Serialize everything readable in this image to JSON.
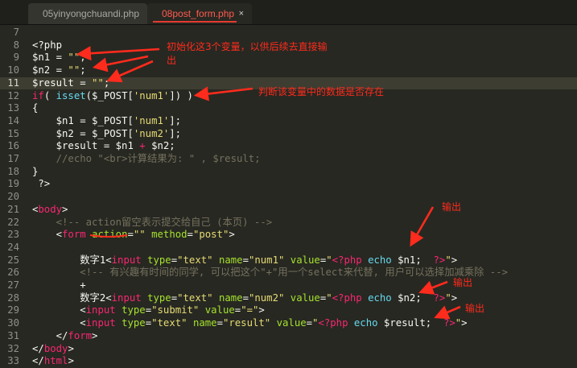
{
  "tabs": [
    {
      "label": "05yinyongchuandi.php",
      "close": "×",
      "active": false
    },
    {
      "label": "08post_form.php",
      "close": "×",
      "active": true
    }
  ],
  "lines": [
    {
      "n": "7",
      "t": [
        [
          "v",
          ""
        ]
      ]
    },
    {
      "n": "8",
      "t": [
        [
          "v",
          "<?php"
        ]
      ]
    },
    {
      "n": "9",
      "t": [
        [
          "v",
          "$n1 = "
        ],
        [
          "s",
          "\"\""
        ],
        [
          "v",
          ";"
        ]
      ]
    },
    {
      "n": "10",
      "t": [
        [
          "v",
          "$n2 = "
        ],
        [
          "s",
          "\"\""
        ],
        [
          "v",
          ";"
        ]
      ]
    },
    {
      "n": "11",
      "t": [
        [
          "v",
          "$result = "
        ],
        [
          "s",
          "\"\""
        ],
        [
          "v",
          ";"
        ]
      ],
      "current": true
    },
    {
      "n": "12",
      "t": [
        [
          "k",
          "if"
        ],
        [
          "v",
          "( "
        ],
        [
          "f",
          "isset"
        ],
        [
          "v",
          "($_POST["
        ],
        [
          "s",
          "'num1'"
        ],
        [
          "v",
          "]) )"
        ]
      ]
    },
    {
      "n": "13",
      "t": [
        [
          "v",
          "{"
        ]
      ]
    },
    {
      "n": "14",
      "t": [
        [
          "v",
          "    $n1 = $_POST["
        ],
        [
          "s",
          "'num1'"
        ],
        [
          "v",
          "];"
        ]
      ]
    },
    {
      "n": "15",
      "t": [
        [
          "v",
          "    $n2 = $_POST["
        ],
        [
          "s",
          "'num2'"
        ],
        [
          "v",
          "];"
        ]
      ]
    },
    {
      "n": "16",
      "t": [
        [
          "v",
          "    $result = $n1 "
        ],
        [
          "k",
          "+"
        ],
        [
          "v",
          " $n2;"
        ]
      ]
    },
    {
      "n": "17",
      "t": [
        [
          "c",
          "    //echo \"<br>计算结果为: \" , $result;"
        ]
      ]
    },
    {
      "n": "18",
      "t": [
        [
          "v",
          "}"
        ]
      ]
    },
    {
      "n": "19",
      "t": [
        [
          "v",
          " ?>"
        ]
      ]
    },
    {
      "n": "20",
      "t": [
        [
          "v",
          ""
        ]
      ]
    },
    {
      "n": "21",
      "t": [
        [
          "v",
          "<"
        ],
        [
          "t",
          "body"
        ],
        [
          "v",
          ">"
        ]
      ]
    },
    {
      "n": "22",
      "t": [
        [
          "c",
          "    <!-- action留空表示提交给自己 (本页) -->"
        ]
      ]
    },
    {
      "n": "23",
      "t": [
        [
          "v",
          "    <"
        ],
        [
          "t",
          "form"
        ],
        [
          "v",
          " "
        ],
        [
          "a",
          "action"
        ],
        [
          "v",
          "="
        ],
        [
          "s",
          "\"\""
        ],
        [
          "v",
          " "
        ],
        [
          "a",
          "method"
        ],
        [
          "v",
          "="
        ],
        [
          "s",
          "\"post\""
        ],
        [
          "v",
          ">"
        ]
      ]
    },
    {
      "n": "24",
      "t": [
        [
          "v",
          ""
        ]
      ]
    },
    {
      "n": "25",
      "t": [
        [
          "v",
          "        数字1<"
        ],
        [
          "t",
          "input"
        ],
        [
          "v",
          " "
        ],
        [
          "a",
          "type"
        ],
        [
          "v",
          "="
        ],
        [
          "s",
          "\"text\""
        ],
        [
          "v",
          " "
        ],
        [
          "a",
          "name"
        ],
        [
          "v",
          "="
        ],
        [
          "s",
          "\"num1\""
        ],
        [
          "v",
          " "
        ],
        [
          "a",
          "value"
        ],
        [
          "v",
          "="
        ],
        [
          "s",
          "\""
        ],
        [
          "ph",
          "<?php"
        ],
        [
          "v",
          " "
        ],
        [
          "f",
          "echo"
        ],
        [
          "v",
          " $n1;  "
        ],
        [
          "ph",
          "?>"
        ],
        [
          "s",
          "\""
        ],
        [
          "v",
          ">"
        ]
      ]
    },
    {
      "n": "26",
      "t": [
        [
          "c",
          "        <!-- 有兴趣有时间的同学, 可以把这个\"+\"用一个select来代替, 用户可以选择加减乘除 -->"
        ]
      ]
    },
    {
      "n": "27",
      "t": [
        [
          "v",
          "        +"
        ]
      ]
    },
    {
      "n": "28",
      "t": [
        [
          "v",
          "        数字2<"
        ],
        [
          "t",
          "input"
        ],
        [
          "v",
          " "
        ],
        [
          "a",
          "type"
        ],
        [
          "v",
          "="
        ],
        [
          "s",
          "\"text\""
        ],
        [
          "v",
          " "
        ],
        [
          "a",
          "name"
        ],
        [
          "v",
          "="
        ],
        [
          "s",
          "\"num2\""
        ],
        [
          "v",
          " "
        ],
        [
          "a",
          "value"
        ],
        [
          "v",
          "="
        ],
        [
          "s",
          "\""
        ],
        [
          "ph",
          "<?php"
        ],
        [
          "v",
          " "
        ],
        [
          "f",
          "echo"
        ],
        [
          "v",
          " $n2;  "
        ],
        [
          "ph",
          "?>"
        ],
        [
          "s",
          "\""
        ],
        [
          "v",
          ">"
        ]
      ]
    },
    {
      "n": "29",
      "t": [
        [
          "v",
          "        <"
        ],
        [
          "t",
          "input"
        ],
        [
          "v",
          " "
        ],
        [
          "a",
          "type"
        ],
        [
          "v",
          "="
        ],
        [
          "s",
          "\"submit\""
        ],
        [
          "v",
          " "
        ],
        [
          "a",
          "value"
        ],
        [
          "v",
          "="
        ],
        [
          "s",
          "\"=\""
        ],
        [
          "v",
          ">"
        ]
      ]
    },
    {
      "n": "30",
      "t": [
        [
          "v",
          "        <"
        ],
        [
          "t",
          "input"
        ],
        [
          "v",
          " "
        ],
        [
          "a",
          "type"
        ],
        [
          "v",
          "="
        ],
        [
          "s",
          "\"text\""
        ],
        [
          "v",
          " "
        ],
        [
          "a",
          "name"
        ],
        [
          "v",
          "="
        ],
        [
          "s",
          "\"result\""
        ],
        [
          "v",
          " "
        ],
        [
          "a",
          "value"
        ],
        [
          "v",
          "="
        ],
        [
          "s",
          "\""
        ],
        [
          "ph",
          "<?php"
        ],
        [
          "v",
          " "
        ],
        [
          "f",
          "echo"
        ],
        [
          "v",
          " $result;  "
        ],
        [
          "ph",
          "?>"
        ],
        [
          "s",
          "\""
        ],
        [
          "v",
          ">"
        ]
      ]
    },
    {
      "n": "31",
      "t": [
        [
          "v",
          "    </"
        ],
        [
          "t",
          "form"
        ],
        [
          "v",
          ">"
        ]
      ]
    },
    {
      "n": "32",
      "t": [
        [
          "v",
          "</"
        ],
        [
          "t",
          "body"
        ],
        [
          "v",
          ">"
        ]
      ]
    },
    {
      "n": "33",
      "t": [
        [
          "v",
          "</"
        ],
        [
          "t",
          "html"
        ],
        [
          "v",
          ">"
        ]
      ]
    }
  ],
  "annotations": {
    "init_note_line1": "初始化这3个变量，以供后续去直接输",
    "init_note_line2": "出",
    "isset_note": "判断该变量中的数据是否存在",
    "output1": "输出",
    "output2": "输出",
    "output3": "输出"
  },
  "colors": {
    "background": "#272822",
    "annotation_red": "#ff2b1c",
    "keyword": "#f92672",
    "string": "#e6db74",
    "function": "#66d9ef",
    "attribute": "#a6e22e",
    "comment": "#75715e"
  }
}
